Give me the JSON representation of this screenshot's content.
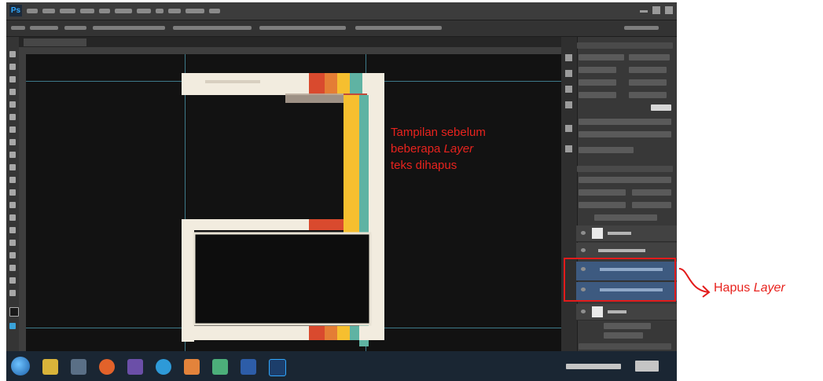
{
  "app": {
    "logo": "Ps",
    "name": "Adobe Photoshop"
  },
  "annotations": {
    "before_text_line1": "Tampilan sebelum",
    "before_text_line2_a": "beberapa ",
    "before_text_line2_b": "Layer",
    "before_text_line3": "teks dihapus",
    "delete_label_a": "Hapus ",
    "delete_label_b": "Layer"
  },
  "colors": {
    "annotation": "#e8231e",
    "cream": "#f2ecdf",
    "red_stripe": "#d94a2e",
    "orange_stripe": "#f0a53a",
    "yellow_stripe": "#f6bf2f",
    "teal_stripe": "#5fb3a3",
    "selected_layer": "#3d5a80"
  },
  "icons": [
    "photoshop-logo-icon",
    "minimize-icon",
    "maximize-icon",
    "close-icon",
    "start-orb-icon",
    "firefox-icon",
    "word-icon",
    "visual-studio-icon",
    "chrome-icon",
    "eye-icon"
  ]
}
